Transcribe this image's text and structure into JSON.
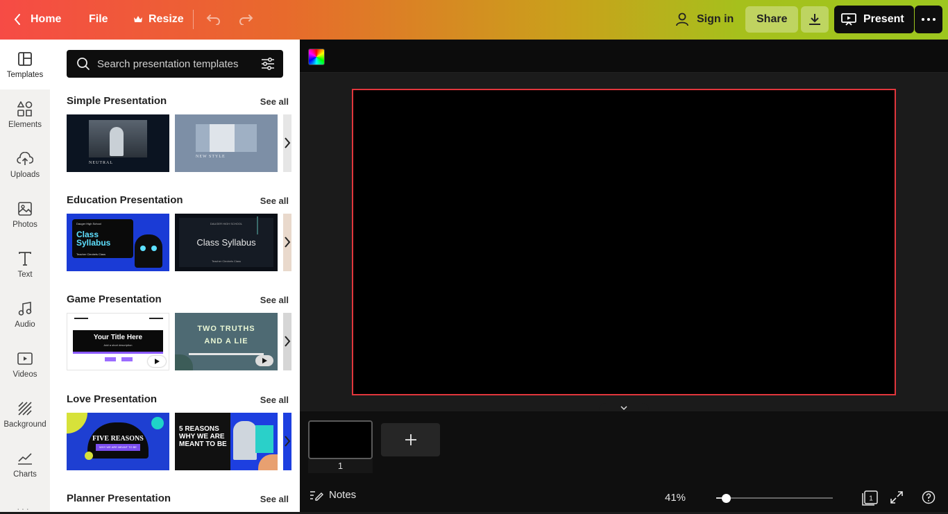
{
  "topbar": {
    "home_label": "Home",
    "file_label": "File",
    "resize_label": "Resize",
    "signin_label": "Sign in",
    "share_label": "Share",
    "present_label": "Present"
  },
  "sidenav": {
    "items": [
      {
        "label": "Templates",
        "icon": "templates-icon"
      },
      {
        "label": "Elements",
        "icon": "elements-icon"
      },
      {
        "label": "Uploads",
        "icon": "upload-cloud-icon"
      },
      {
        "label": "Photos",
        "icon": "photo-icon"
      },
      {
        "label": "Text",
        "icon": "text-icon"
      },
      {
        "label": "Audio",
        "icon": "music-note-icon"
      },
      {
        "label": "Videos",
        "icon": "video-icon"
      },
      {
        "label": "Background",
        "icon": "background-hatch-icon"
      },
      {
        "label": "Charts",
        "icon": "chart-line-icon"
      }
    ]
  },
  "panel": {
    "search": {
      "placeholder": "Search presentation templates"
    },
    "see_all_label": "See all",
    "sections": [
      {
        "title": "Simple Presentation",
        "thumbs": [
          {
            "text": "NEUTRAL"
          },
          {
            "text": "NEW STYLE"
          }
        ]
      },
      {
        "title": "Education Presentation",
        "thumbs": [
          {
            "text": "Class Syllabus",
            "small": "Dauger High School",
            "footer": "Teacher Cleobels Class"
          },
          {
            "text": "Class Syllabus",
            "small": "DAUGER HIGH SCHOOL",
            "footer": "Teacher Cleobels Class"
          }
        ]
      },
      {
        "title": "Game Presentation",
        "thumbs": [
          {
            "text": "Your Title Here",
            "small": "Add a short description"
          },
          {
            "text": "TWO TRUTHS AND A LIE"
          }
        ]
      },
      {
        "title": "Love Presentation",
        "thumbs": [
          {
            "text": "FIVE REASONS",
            "small": "WHY WE ARE MEANT TO BE"
          },
          {
            "text": "5 REASONS WHY WE ARE MEANT TO BE"
          }
        ]
      },
      {
        "title": "Planner Presentation",
        "thumbs": []
      }
    ]
  },
  "canvas": {
    "accent_border": "#e1363c",
    "page_number": "1"
  },
  "footer": {
    "notes_label": "Notes",
    "zoom_label": "41%",
    "zoom_fraction": 0.05
  }
}
